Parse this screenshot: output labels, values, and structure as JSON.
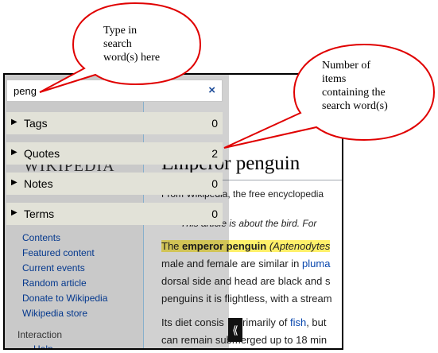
{
  "search": {
    "value": "peng",
    "clear_icon": "×"
  },
  "categories": [
    {
      "label": "Tags",
      "count": "0"
    },
    {
      "label": "Quotes",
      "count": "2"
    },
    {
      "label": "Notes",
      "count": "0"
    },
    {
      "label": "Terms",
      "count": "0"
    }
  ],
  "callouts": {
    "search_note": [
      "Type in",
      "search",
      "word(s) here"
    ],
    "count_note": [
      "Number of",
      "items",
      "containing the",
      "search word(s)"
    ]
  },
  "wiki": {
    "logo_text": "WIKIPEDIA",
    "nav": [
      "Contents",
      "Featured content",
      "Current events",
      "Random article",
      "Donate to Wikipedia",
      "Wikipedia store"
    ],
    "interaction_heading": "Interaction",
    "interaction_first": "Help",
    "title": "Emperor penguin",
    "subtitle": "From Wikipedia, the free encyclopedia",
    "hatnote": "This article is about the bird. For",
    "lines": [
      {
        "pre": "The ",
        "bold": "emperor penguin",
        "post": " (Aptenodytes"
      },
      {
        "pre": "male and female are similar in ",
        "link": "pluma"
      },
      {
        "pre": "dorsal side and head are black and s"
      },
      {
        "pre": "penguins it is flightless, with a stream"
      },
      {
        "pre": "Its diet consis",
        "mid": "primarily of ",
        "link": "fish",
        "post": ", but"
      },
      {
        "pre": "can remain submerged up to 18 min"
      }
    ]
  },
  "colors": {
    "callout_stroke": "#e00000",
    "panel_row": "#e2e2d8",
    "link": "#0645ad"
  }
}
